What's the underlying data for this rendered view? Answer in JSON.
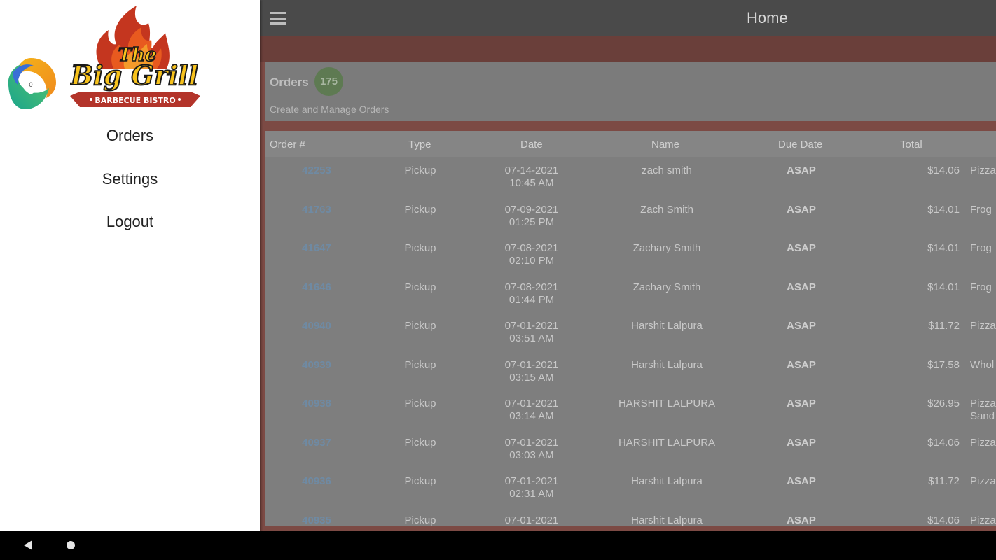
{
  "header": {
    "title": "Home",
    "menu_icon": "hamburger-menu-icon"
  },
  "orders_summary": {
    "heading": "Orders",
    "count": "175",
    "subtitle": "Create and Manage Orders"
  },
  "table": {
    "columns": [
      "Order #",
      "Type",
      "Date",
      "Name",
      "Due Date",
      "Total"
    ],
    "rows": [
      {
        "order": "42253",
        "type": "Pickup",
        "date": "07-14-2021",
        "time": "10:45 AM",
        "name": "zach smith",
        "due": "ASAP",
        "total": "$14.06",
        "items": "Pizza"
      },
      {
        "order": "41763",
        "type": "Pickup",
        "date": "07-09-2021",
        "time": "01:25 PM",
        "name": "Zach Smith",
        "due": "ASAP",
        "total": "$14.01",
        "items": "Frog"
      },
      {
        "order": "41647",
        "type": "Pickup",
        "date": "07-08-2021",
        "time": "02:10 PM",
        "name": "Zachary Smith",
        "due": "ASAP",
        "total": "$14.01",
        "items": "Frog"
      },
      {
        "order": "41646",
        "type": "Pickup",
        "date": "07-08-2021",
        "time": "01:44 PM",
        "name": "Zachary Smith",
        "due": "ASAP",
        "total": "$14.01",
        "items": "Frog"
      },
      {
        "order": "40940",
        "type": "Pickup",
        "date": "07-01-2021",
        "time": "03:51 AM",
        "name": "Harshit Lalpura",
        "due": "ASAP",
        "total": "$11.72",
        "items": "Pizza"
      },
      {
        "order": "40939",
        "type": "Pickup",
        "date": "07-01-2021",
        "time": "03:15 AM",
        "name": "Harshit Lalpura",
        "due": "ASAP",
        "total": "$17.58",
        "items": "Whol"
      },
      {
        "order": "40938",
        "type": "Pickup",
        "date": "07-01-2021",
        "time": "03:14 AM",
        "name": "HARSHIT LALPURA",
        "due": "ASAP",
        "total": "$26.95",
        "items": "Pizza",
        "items2": "Sand"
      },
      {
        "order": "40937",
        "type": "Pickup",
        "date": "07-01-2021",
        "time": "03:03 AM",
        "name": "HARSHIT LALPURA",
        "due": "ASAP",
        "total": "$14.06",
        "items": "Pizza"
      },
      {
        "order": "40936",
        "type": "Pickup",
        "date": "07-01-2021",
        "time": "02:31 AM",
        "name": "Harshit Lalpura",
        "due": "ASAP",
        "total": "$11.72",
        "items": "Pizza"
      },
      {
        "order": "40935",
        "type": "Pickup",
        "date": "07-01-2021",
        "time": "",
        "name": "Harshit Lalpura",
        "due": "ASAP",
        "total": "$14.06",
        "items": "Pizza"
      }
    ]
  },
  "drawer": {
    "brand": {
      "line1": "The",
      "line2": "Big Grill",
      "tagline": "BARBECUE BISTRO"
    },
    "vpn_badge": "0",
    "nav": [
      {
        "label": "Orders"
      },
      {
        "label": "Settings"
      },
      {
        "label": "Logout"
      }
    ]
  },
  "colors": {
    "accent_red": "#b3342a",
    "drawer_bg": "#ffffff",
    "topbar": "#4a4a4a",
    "order_link": "#6f8aa3",
    "count_badge": "#5e7a52"
  },
  "system_nav": {
    "back_icon": "back-triangle-icon",
    "home_icon": "home-circle-icon"
  }
}
